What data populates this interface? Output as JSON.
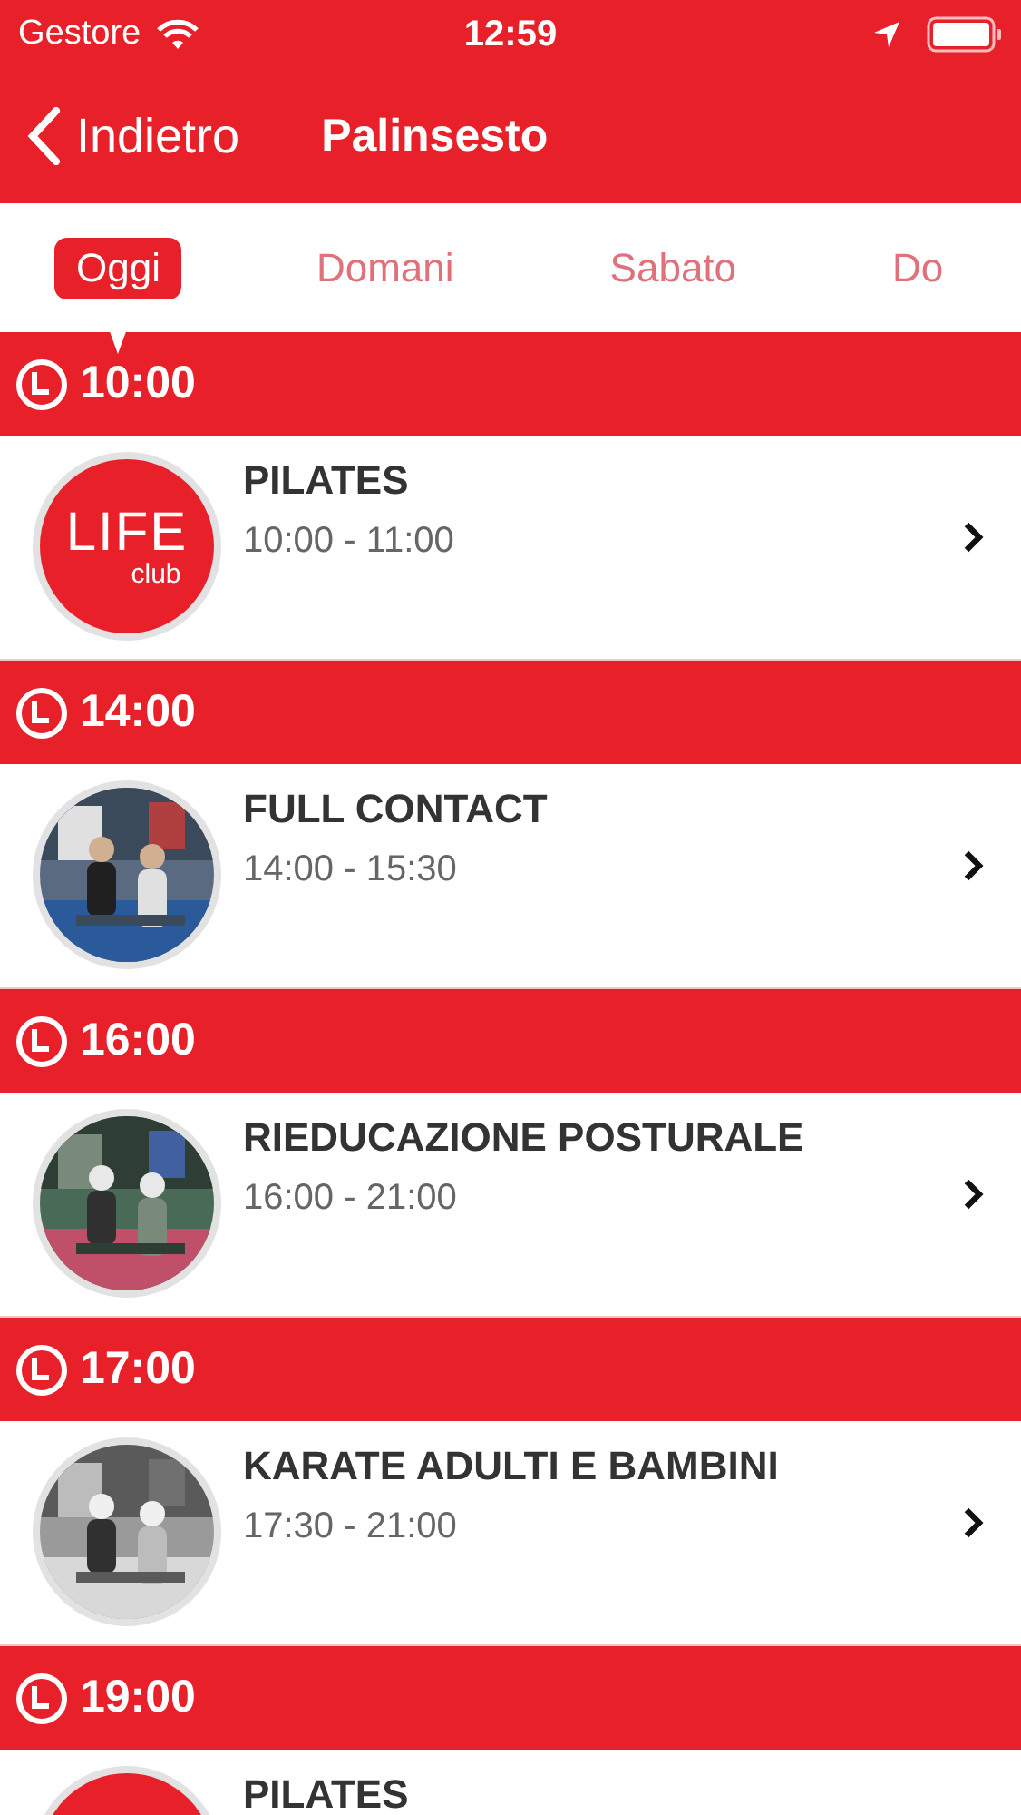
{
  "status_bar": {
    "carrier": "Gestore",
    "time": "12:59"
  },
  "nav": {
    "back": "Indietro",
    "title": "Palinsesto"
  },
  "tabs": [
    {
      "label": "Oggi",
      "selected": true
    },
    {
      "label": "Domani",
      "selected": false
    },
    {
      "label": "Sabato",
      "selected": false
    },
    {
      "label": "Do",
      "selected": false
    }
  ],
  "sections": [
    {
      "time": "10:00",
      "items": [
        {
          "title": "PILATES",
          "hours": "10:00 - 11:00",
          "avatar": {
            "kind": "logo",
            "word": "LIFE",
            "sub": "club"
          }
        }
      ]
    },
    {
      "time": "14:00",
      "items": [
        {
          "title": "FULL CONTACT",
          "hours": "14:00 - 15:30"
        }
      ]
    },
    {
      "time": "16:00",
      "items": [
        {
          "title": "RIEDUCAZIONE POSTURALE",
          "hours": "16:00 - 21:00"
        }
      ]
    },
    {
      "time": "17:00",
      "items": [
        {
          "title": "KARATE ADULTI E BAMBINI",
          "hours": "17:30 - 21:00"
        }
      ]
    },
    {
      "time": "19:00",
      "items": [
        {
          "title": "PILATES",
          "avatar": {
            "kind": "logo"
          }
        }
      ]
    }
  ]
}
